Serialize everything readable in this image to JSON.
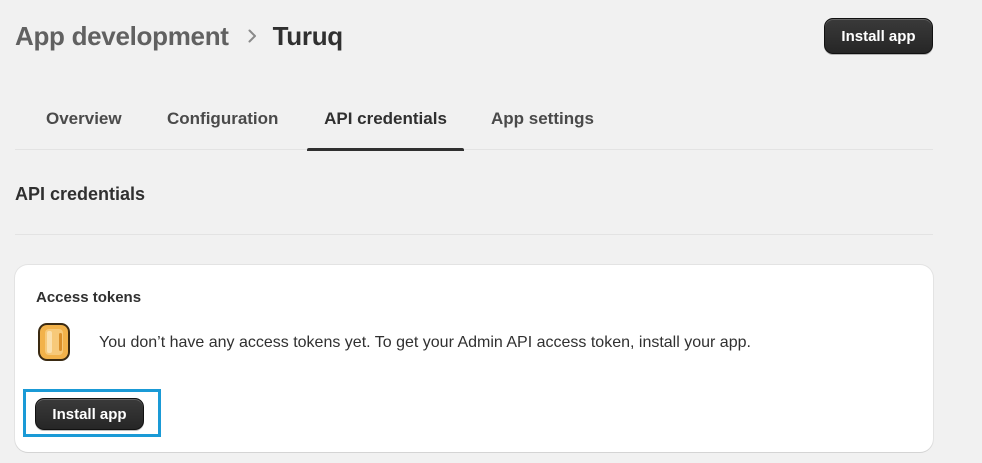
{
  "header": {
    "breadcrumb_parent": "App development",
    "breadcrumb_current": "Turuq",
    "install_button_label": "Install app"
  },
  "tabs": [
    {
      "label": "Overview",
      "active": false
    },
    {
      "label": "Configuration",
      "active": false
    },
    {
      "label": "API credentials",
      "active": true
    },
    {
      "label": "App settings",
      "active": false
    }
  ],
  "section": {
    "title": "API credentials"
  },
  "access_tokens_card": {
    "title": "Access tokens",
    "icon": "coin-icon",
    "message": "You don’t have any access tokens yet. To get your Admin API access token, install your app.",
    "install_button_label": "Install app",
    "highlight_color": "#1a9ad6"
  },
  "colors": {
    "background": "#f1f1f1",
    "card": "#ffffff",
    "button_dark": "#303030",
    "coin": "#f2b24a"
  }
}
